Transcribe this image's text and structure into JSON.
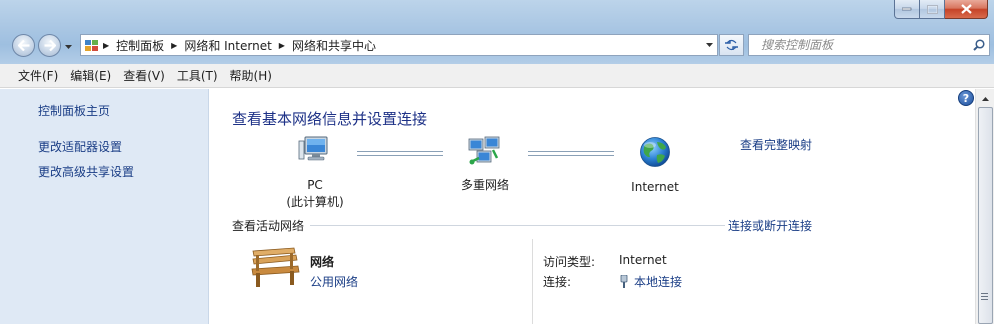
{
  "window": {
    "caption_buttons": [
      "minimize",
      "maximize",
      "close"
    ]
  },
  "address_bar": {
    "crumbs": [
      "控制面板",
      "网络和 Internet",
      "网络和共享中心"
    ]
  },
  "search": {
    "placeholder": "搜索控制面板"
  },
  "menu": [
    "文件(F)",
    "编辑(E)",
    "查看(V)",
    "工具(T)",
    "帮助(H)"
  ],
  "sidebar": {
    "home": "控制面板主页",
    "links": [
      "更改适配器设置",
      "更改高级共享设置"
    ]
  },
  "main": {
    "title": "查看基本网络信息并设置连接",
    "full_map": "查看完整映射",
    "nodes": [
      {
        "label_line1": "PC",
        "label_line2": "(此计算机)",
        "icon": "computer-icon"
      },
      {
        "label_line1": "多重网络",
        "label_line2": "",
        "icon": "multiple-networks-icon"
      },
      {
        "label_line1": "Internet",
        "label_line2": "",
        "icon": "globe-icon"
      }
    ],
    "active_networks_title": "查看活动网络",
    "connect_disconnect": "连接或断开连接",
    "network": {
      "name": "网络",
      "type": "公用网络",
      "access_type_label": "访问类型:",
      "access_type_value": "Internet",
      "connections_label": "连接:",
      "connections_value": "本地连接"
    }
  },
  "colors": {
    "link": "#1b3e86",
    "title": "#1e3287",
    "sidebar_bg": "#dfe9f5"
  }
}
